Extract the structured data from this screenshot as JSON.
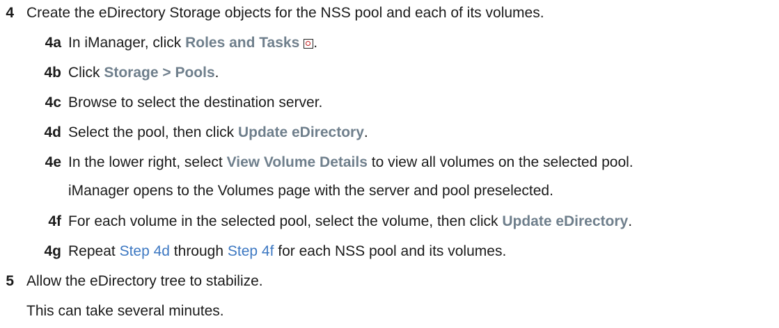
{
  "steps": [
    {
      "number": "4",
      "text": "Create the eDirectory Storage objects for the NSS pool and each of its volumes.",
      "substeps": [
        {
          "number": "4a",
          "pre": "In iManager, click ",
          "ui": "Roles and Tasks",
          "post": ".",
          "icon": "roles-and-tasks-icon"
        },
        {
          "number": "4b",
          "pre": "Click ",
          "ui": "Storage > Pools",
          "post": "."
        },
        {
          "number": "4c",
          "text": "Browse to select the destination server."
        },
        {
          "number": "4d",
          "pre": "Select the pool, then click ",
          "ui": "Update eDirectory",
          "post": "."
        },
        {
          "number": "4e",
          "pre": "In the lower right, select ",
          "ui": "View Volume Details",
          "post": " to view all volumes on the selected pool.",
          "note": "iManager opens to the Volumes page with the server and pool preselected."
        },
        {
          "number": "4f",
          "pre": "For each volume in the selected pool, select the volume, then click ",
          "ui": "Update eDirectory",
          "post": "."
        },
        {
          "number": "4g",
          "pre": "Repeat ",
          "link1": "Step 4d",
          "mid": " through ",
          "link2": "Step 4f",
          "post": " for each NSS pool and its volumes."
        }
      ]
    },
    {
      "number": "5",
      "text": "Allow the eDirectory tree to stabilize.",
      "note": "This can take several minutes."
    }
  ]
}
